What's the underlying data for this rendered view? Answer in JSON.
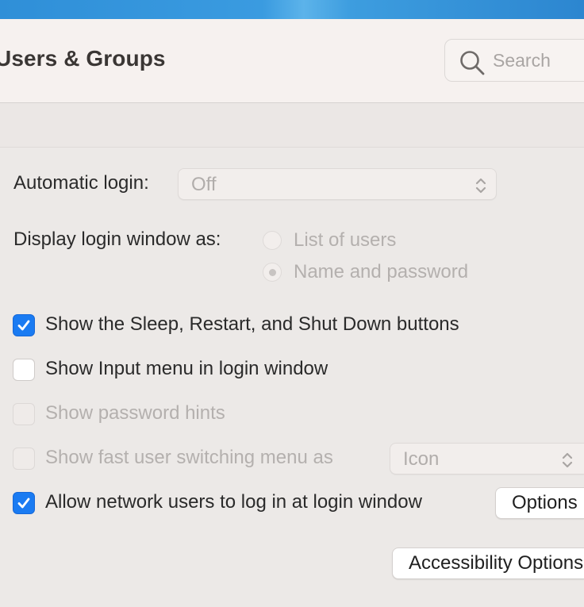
{
  "window": {
    "title": "Users & Groups"
  },
  "search": {
    "placeholder": "Search",
    "value": ""
  },
  "login_options": {
    "automatic_login": {
      "label": "Automatic login:",
      "value": "Off"
    },
    "display_login_window": {
      "label": "Display login window as:",
      "options": [
        {
          "label": "List of users",
          "selected": false
        },
        {
          "label": "Name and password",
          "selected": true
        }
      ]
    },
    "checkboxes": [
      {
        "label": "Show the Sleep, Restart, and Shut Down buttons",
        "checked": true,
        "enabled": true
      },
      {
        "label": "Show Input menu in login window",
        "checked": false,
        "enabled": true
      },
      {
        "label": "Show password hints",
        "checked": false,
        "enabled": false
      },
      {
        "label": "Show fast user switching menu as",
        "checked": false,
        "enabled": false
      },
      {
        "label": "Allow network users to log in at login window",
        "checked": true,
        "enabled": true
      }
    ],
    "fast_user_switching_value": "Icon",
    "options_button": "Options",
    "accessibility_button": "Accessibility Options"
  },
  "icons": {
    "search": "magnifying-glass-icon",
    "popup_arrows": "chevron-up-down-icon",
    "checkmark": "checkmark-icon"
  },
  "colors": {
    "accent": "#1a7bf2",
    "window_background": "#ece9e7",
    "toolbar_background": "#f6f1ef"
  }
}
